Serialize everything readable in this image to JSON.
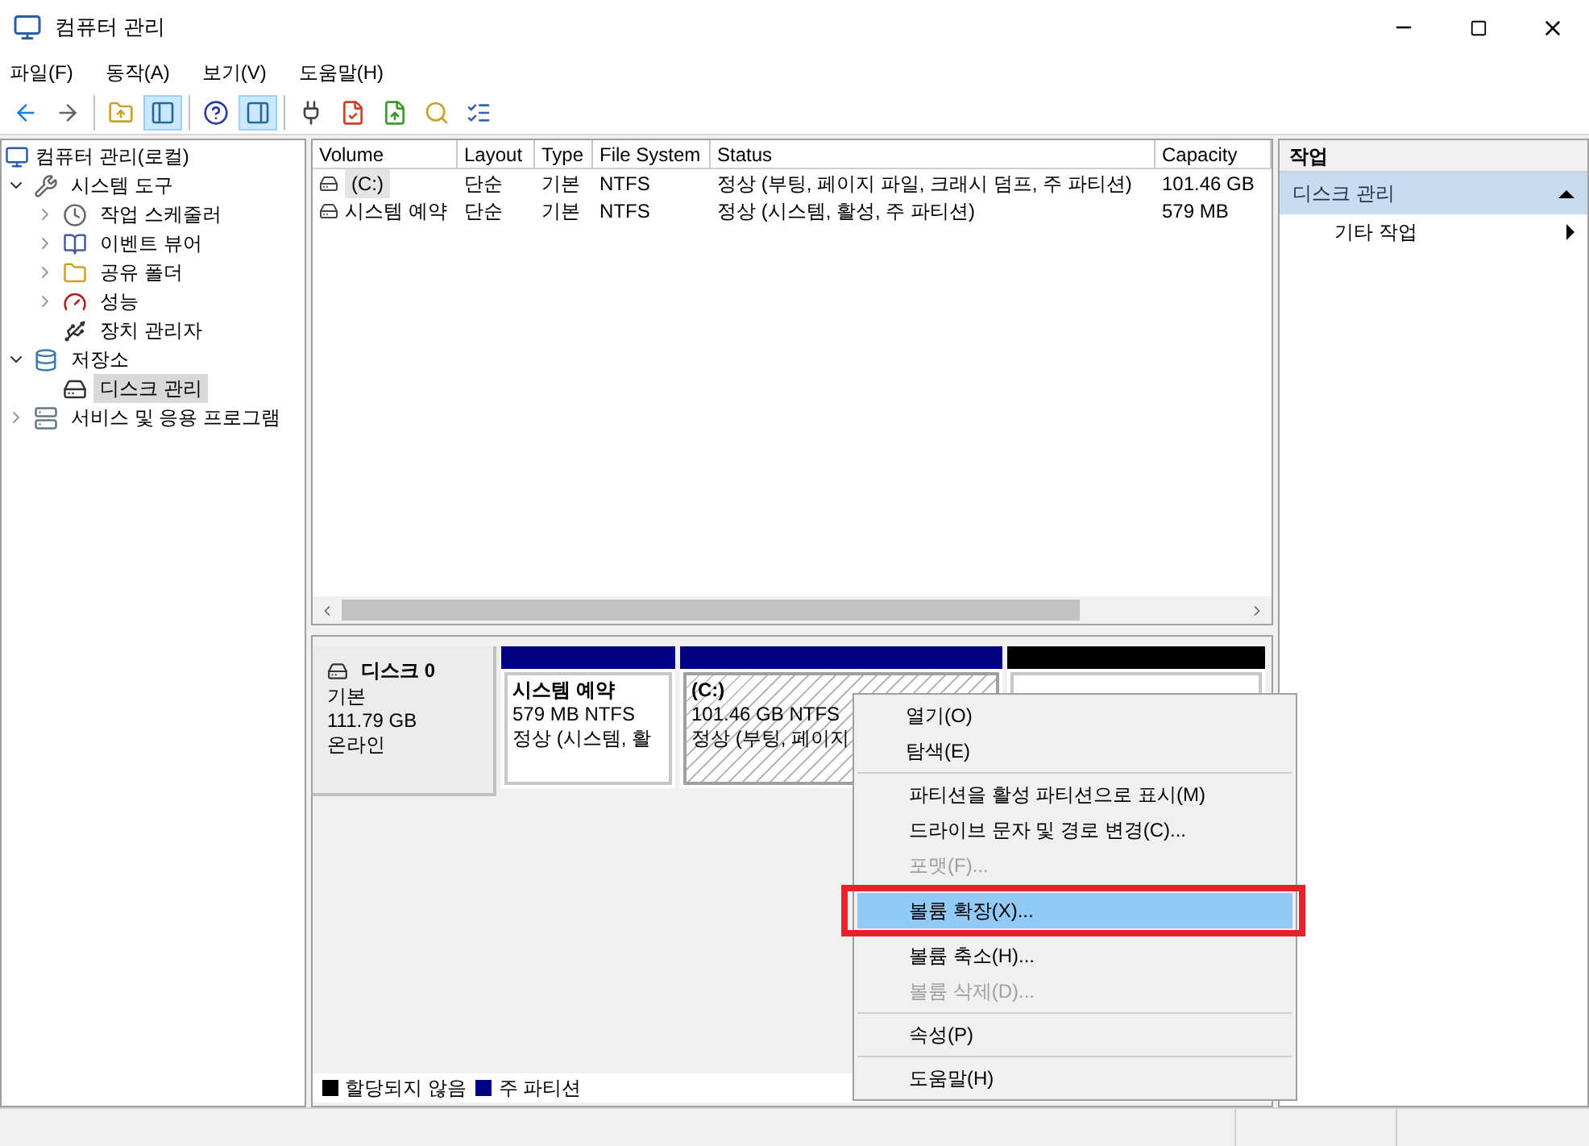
{
  "window": {
    "title": "컴퓨터 관리"
  },
  "menu_bar": [
    "파일(F)",
    "동작(A)",
    "보기(V)",
    "도움말(H)"
  ],
  "toolbar": [
    [
      {
        "kind": "back",
        "pressed": false
      },
      {
        "kind": "forward",
        "pressed": false
      }
    ],
    [
      {
        "kind": "up",
        "pressed": false
      },
      {
        "kind": "tree",
        "pressed": true
      }
    ],
    [
      {
        "kind": "help",
        "pressed": false
      },
      {
        "kind": "actions",
        "pressed": true
      }
    ],
    [
      {
        "kind": "connect",
        "pressed": false
      },
      {
        "kind": "check",
        "pressed": false
      },
      {
        "kind": "export",
        "pressed": false
      },
      {
        "kind": "find",
        "pressed": false
      },
      {
        "kind": "list",
        "pressed": false
      }
    ]
  ],
  "tree": [
    {
      "label": "컴퓨터 관리(로컬)",
      "kind": "computer",
      "selected": false,
      "children": [
        {
          "label": "시스템 도구",
          "kind": "tools",
          "selected": false,
          "expanded": true,
          "children": [
            {
              "label": "작업 스케줄러",
              "kind": "clock",
              "selected": false,
              "expanded": false
            },
            {
              "label": "이벤트 뷰어",
              "kind": "log",
              "selected": false,
              "expanded": false
            },
            {
              "label": "공유 폴더",
              "kind": "folder",
              "selected": false,
              "expanded": false
            },
            {
              "label": "성능",
              "kind": "gauge",
              "selected": false,
              "expanded": false
            },
            {
              "label": "장치 관리자",
              "kind": "device",
              "selected": false
            }
          ]
        },
        {
          "label": "저장소",
          "kind": "storage",
          "selected": false,
          "expanded": true,
          "children": [
            {
              "label": "디스크 관리",
              "kind": "disk",
              "selected": true
            }
          ]
        },
        {
          "label": "서비스 및 응용 프로그램",
          "kind": "services",
          "selected": false,
          "expanded": false
        }
      ]
    }
  ],
  "table": {
    "columns": [
      "Volume",
      "Layout",
      "Type",
      "File System",
      "Status",
      "Capacity"
    ],
    "rows": [
      {
        "selected": true,
        "cells": [
          "(C:)",
          "단순",
          "기본",
          "NTFS",
          "정상 (부팅, 페이지 파일, 크래시 덤프, 주 파티션)",
          "101.46 GB"
        ]
      },
      {
        "selected": false,
        "cells": [
          "시스템 예약",
          "단순",
          "기본",
          "NTFS",
          "정상 (시스템, 활성, 주 파티션)",
          "579 MB"
        ]
      }
    ]
  },
  "disk": {
    "name": "디스크 0",
    "lines": [
      "기본",
      "111.79 GB",
      "온라인"
    ],
    "partitions": [
      {
        "color": "#000080",
        "selected": false,
        "name": "시스템 예약",
        "size": "579 MB NTFS",
        "status": "정상 (시스템, 활"
      },
      {
        "color": "#000080",
        "selected": true,
        "name": "(C:)",
        "size": "101.46 GB NTFS",
        "status": "정상 (부팅, 페이지"
      },
      {
        "color": "#000000",
        "selected": false
      }
    ]
  },
  "legend": [
    {
      "label": "할당되지 않음",
      "color": "#000000"
    },
    {
      "label": "주 파티션",
      "color": "#000080"
    }
  ],
  "actions": {
    "title": "작업",
    "section": {
      "label": "디스크 관리",
      "expanded": true
    },
    "items": [
      {
        "label": "기타 작업"
      }
    ]
  },
  "context_menu": [
    [
      {
        "label": "열기(O)",
        "disabled": false,
        "selected": false
      },
      {
        "label": "탐색(E)",
        "disabled": false,
        "selected": false
      }
    ],
    [
      {
        "label": "파티션을 활성 파티션으로 표시(M)",
        "disabled": false,
        "selected": false
      },
      {
        "label": "드라이브 문자 및 경로 변경(C)...",
        "disabled": false,
        "selected": false
      },
      {
        "label": "포맷(F)...",
        "disabled": true,
        "selected": false
      },
      {
        "label": "볼륨 확장(X)...",
        "disabled": false,
        "selected": true
      },
      {
        "label": "볼륨 축소(H)...",
        "disabled": false,
        "selected": false
      },
      {
        "label": "볼륨 삭제(D)...",
        "disabled": true,
        "selected": false
      }
    ],
    [
      {
        "label": "속성(P)",
        "disabled": false,
        "selected": false
      }
    ],
    [
      {
        "label": "도움말(H)",
        "disabled": false,
        "selected": false
      }
    ]
  ]
}
